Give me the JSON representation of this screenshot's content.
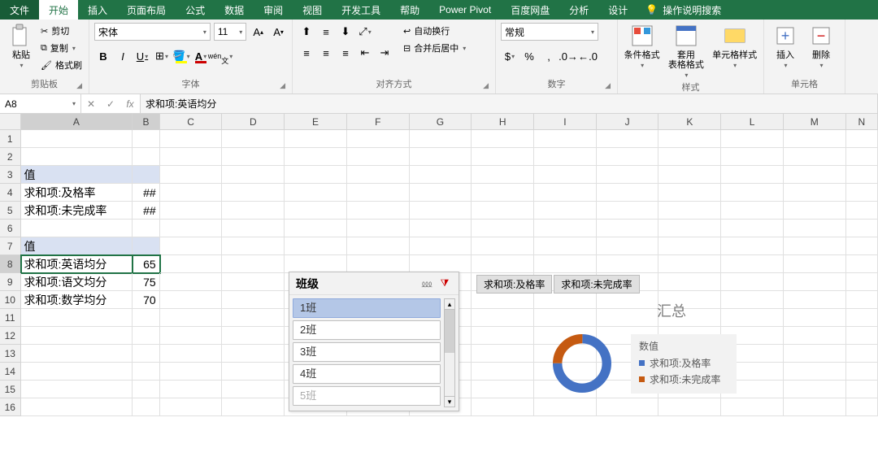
{
  "tabs": {
    "file": "文件",
    "home": "开始",
    "insert": "插入",
    "layout": "页面布局",
    "formula": "公式",
    "data": "数据",
    "review": "审阅",
    "view": "视图",
    "dev": "开发工具",
    "help": "帮助",
    "powerpivot": "Power Pivot",
    "baidu": "百度网盘",
    "analyze": "分析",
    "design": "设计",
    "tellme": "操作说明搜索"
  },
  "clipboard": {
    "paste": "粘贴",
    "cut": "剪切",
    "copy": "复制",
    "fmtpainter": "格式刷",
    "label": "剪贴板"
  },
  "font": {
    "name": "宋体",
    "size": "11",
    "label": "字体",
    "wen": "wén"
  },
  "align": {
    "wrap": "自动换行",
    "merge": "合并后居中",
    "label": "对齐方式"
  },
  "number": {
    "fmt": "常规",
    "label": "数字"
  },
  "styles": {
    "condfmt": "条件格式",
    "tblfmt": "套用\n表格格式",
    "cellstyle": "单元格样式",
    "label": "样式"
  },
  "cells": {
    "insert": "插入",
    "delete": "删除",
    "label": "单元格"
  },
  "namebox": "A8",
  "formula": "求和项:英语均分",
  "cols": [
    "A",
    "B",
    "C",
    "D",
    "E",
    "F",
    "G",
    "H",
    "I",
    "J",
    "K",
    "L",
    "M",
    "N"
  ],
  "data_rows": {
    "r3A": "值",
    "r4A": "求和项:及格率",
    "r4B": "##",
    "r5A": "求和项:未完成率",
    "r5B": "##",
    "r7A": "值",
    "r8A": "求和项:英语均分",
    "r8B": "65",
    "r9A": "求和项:语文均分",
    "r9B": "75",
    "r10A": "求和项:数学均分",
    "r10B": "70"
  },
  "slicer": {
    "title": "班级",
    "items": [
      "1班",
      "2班",
      "3班",
      "4班",
      "5班"
    ]
  },
  "chart": {
    "btn1": "求和项:及格率",
    "btn2": "求和项:未完成率",
    "title": "汇总",
    "legend_title": "数值",
    "legend1": "求和项:及格率",
    "legend2": "求和项:未完成率"
  },
  "chart_data": {
    "type": "pie",
    "title": "汇总",
    "series": [
      {
        "name": "求和项:及格率",
        "color": "#4472c4"
      },
      {
        "name": "求和项:未完成率",
        "color": "#c55a11"
      }
    ],
    "note": "Donut chart; numeric values hidden as ## in cells, proportion approx 75/25 from arc"
  }
}
